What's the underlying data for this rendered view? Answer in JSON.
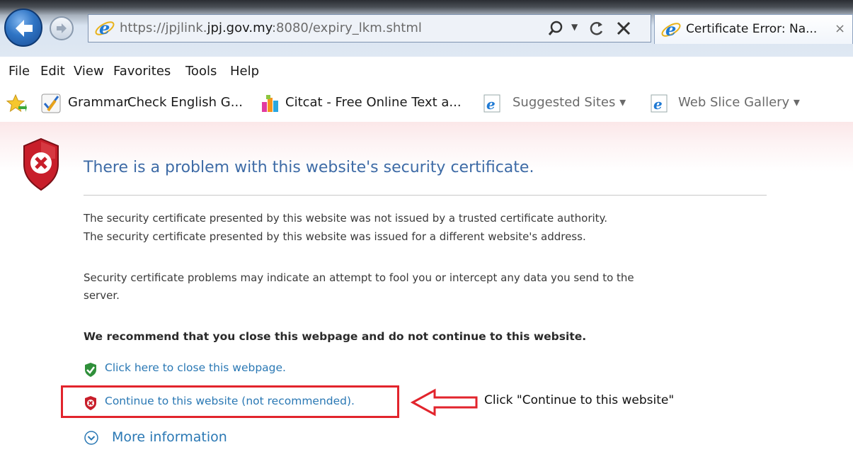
{
  "browser": {
    "url_prefix": "https://jpjlink.",
    "url_domain": "jpj.gov.my",
    "url_suffix": ":8080/expiry_lkm.shtml",
    "tab_title": "Certificate Error: Na...",
    "tab_close": "×"
  },
  "menu": [
    "File",
    "Edit",
    "View",
    "Favorites",
    "Tools",
    "Help"
  ],
  "favorites": [
    {
      "label": "Grammar",
      "icon": "grammar-check-icon"
    },
    {
      "label": "Check English G...",
      "icon": "none"
    },
    {
      "label": "Citcat - Free Online Text a...",
      "icon": "citcat-icon"
    },
    {
      "label": "Suggested Sites ▾",
      "icon": "ie-page-icon"
    },
    {
      "label": "Web Slice Gallery ▾",
      "icon": "ie-page-icon"
    }
  ],
  "page": {
    "heading": "There is a problem with this website's security certificate.",
    "line1": "The security certificate presented by this website was not issued by a trusted certificate authority.",
    "line2": "The security certificate presented by this website was issued for a different website's address.",
    "line3": "Security certificate problems may indicate an attempt to fool you or intercept any data you send to the",
    "line4": "server.",
    "recommend": "We recommend that you close this webpage and do not continue to this website.",
    "close_link": "Click here to close this webpage.",
    "continue_link": "Continue to this website (not recommended).",
    "more_info": "More information"
  },
  "annotation": {
    "instruction": "Click \"Continue to this website\"",
    "highlight_color": "#e2242c"
  },
  "colors": {
    "link": "#2a78b4",
    "heading": "#3e6ba6",
    "error_red": "#c81e2a",
    "safe_green": "#2f8f3a"
  }
}
